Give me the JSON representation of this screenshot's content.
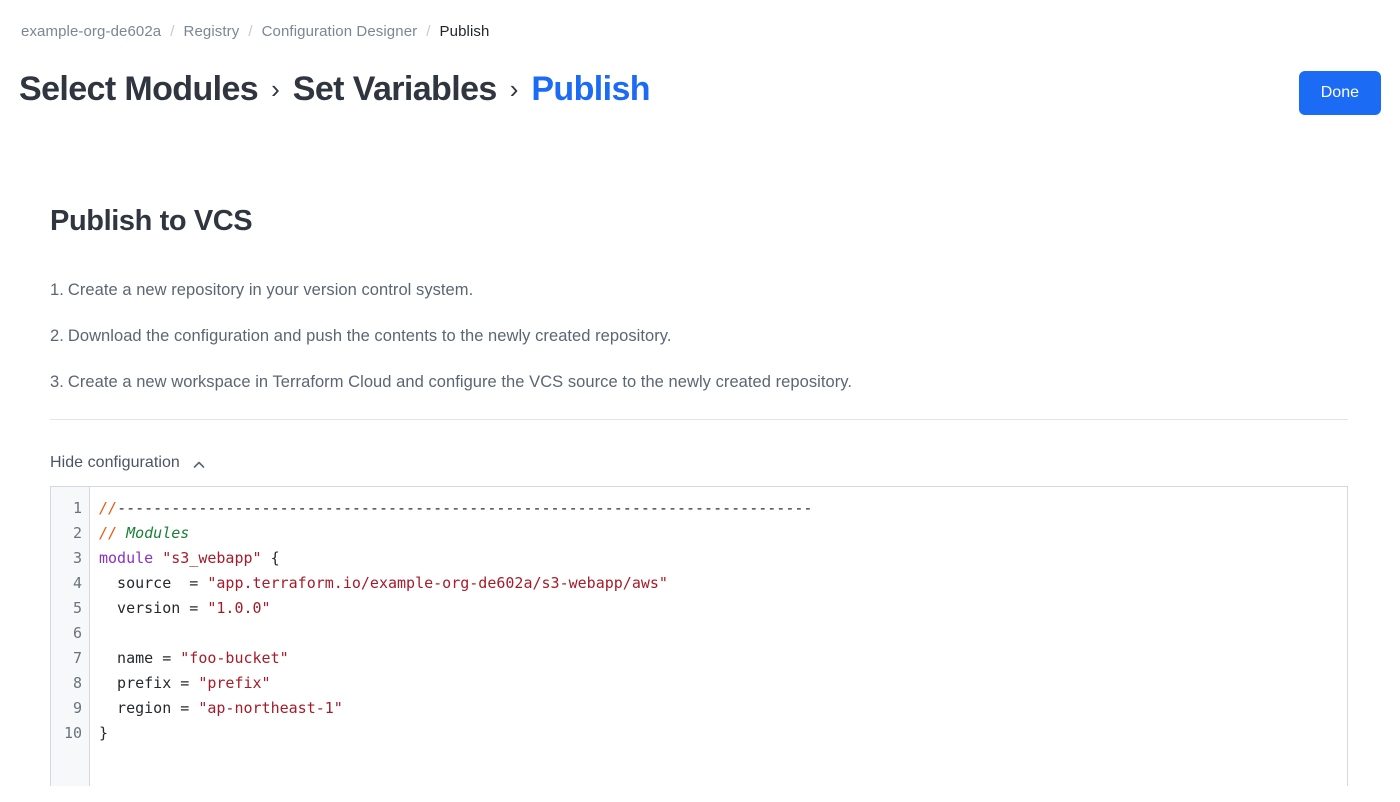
{
  "breadcrumb": {
    "separator": "/",
    "items": [
      {
        "label": "example-org-de602a",
        "current": false
      },
      {
        "label": "Registry",
        "current": false
      },
      {
        "label": "Configuration Designer",
        "current": false
      },
      {
        "label": "Publish",
        "current": true
      }
    ]
  },
  "step_header": {
    "separator": "›",
    "steps": [
      {
        "label": "Select Modules",
        "active": false
      },
      {
        "label": "Set Variables",
        "active": false
      },
      {
        "label": "Publish",
        "active": true
      }
    ],
    "done_label": "Done",
    "accent_color": "#1c6bf5"
  },
  "main": {
    "title": "Publish to VCS",
    "instructions": [
      {
        "num": "1.",
        "text": "Create a new repository in your version control system."
      },
      {
        "num": "2.",
        "text": "Download the configuration and push the contents to the newly created repository."
      },
      {
        "num": "3.",
        "text": "Create a new workspace in Terraform Cloud and configure the VCS source to the newly created repository."
      }
    ],
    "config_toggle_label": "Hide configuration",
    "config_toggle_icon": "chevron-up-icon"
  },
  "code": {
    "language": "hcl",
    "line_numbers": [
      "1",
      "2",
      "3",
      "4",
      "5",
      "6",
      "7",
      "8",
      "9",
      "10"
    ],
    "lines": [
      {
        "n": "1",
        "tokens": [
          {
            "t": "//",
            "c": "tok-comment-slash"
          },
          {
            "t": "-----------------------------------------------------------------------------",
            "c": "tok-comment-rule"
          }
        ]
      },
      {
        "n": "2",
        "tokens": [
          {
            "t": "//",
            "c": "tok-comment-slash"
          },
          {
            "t": " Modules",
            "c": "tok-comment-text"
          }
        ]
      },
      {
        "n": "3",
        "tokens": [
          {
            "t": "module",
            "c": "tok-keyword"
          },
          {
            "t": " ",
            "c": "tok-plain"
          },
          {
            "t": "\"s3_webapp\"",
            "c": "tok-string"
          },
          {
            "t": " {",
            "c": "tok-plain"
          }
        ]
      },
      {
        "n": "4",
        "tokens": [
          {
            "t": "  source  = ",
            "c": "tok-plain"
          },
          {
            "t": "\"app.terraform.io/example-org-de602a/s3-webapp/aws\"",
            "c": "tok-string"
          }
        ]
      },
      {
        "n": "5",
        "tokens": [
          {
            "t": "  version = ",
            "c": "tok-plain"
          },
          {
            "t": "\"1.0.0\"",
            "c": "tok-string"
          }
        ]
      },
      {
        "n": "6",
        "tokens": [
          {
            "t": "",
            "c": "tok-plain"
          }
        ]
      },
      {
        "n": "7",
        "tokens": [
          {
            "t": "  name = ",
            "c": "tok-plain"
          },
          {
            "t": "\"foo-bucket\"",
            "c": "tok-string"
          }
        ]
      },
      {
        "n": "8",
        "tokens": [
          {
            "t": "  prefix = ",
            "c": "tok-plain"
          },
          {
            "t": "\"prefix\"",
            "c": "tok-string"
          }
        ]
      },
      {
        "n": "9",
        "tokens": [
          {
            "t": "  region = ",
            "c": "tok-plain"
          },
          {
            "t": "\"ap-northeast-1\"",
            "c": "tok-string"
          }
        ]
      },
      {
        "n": "10",
        "tokens": [
          {
            "t": "}",
            "c": "tok-plain"
          }
        ]
      }
    ]
  }
}
